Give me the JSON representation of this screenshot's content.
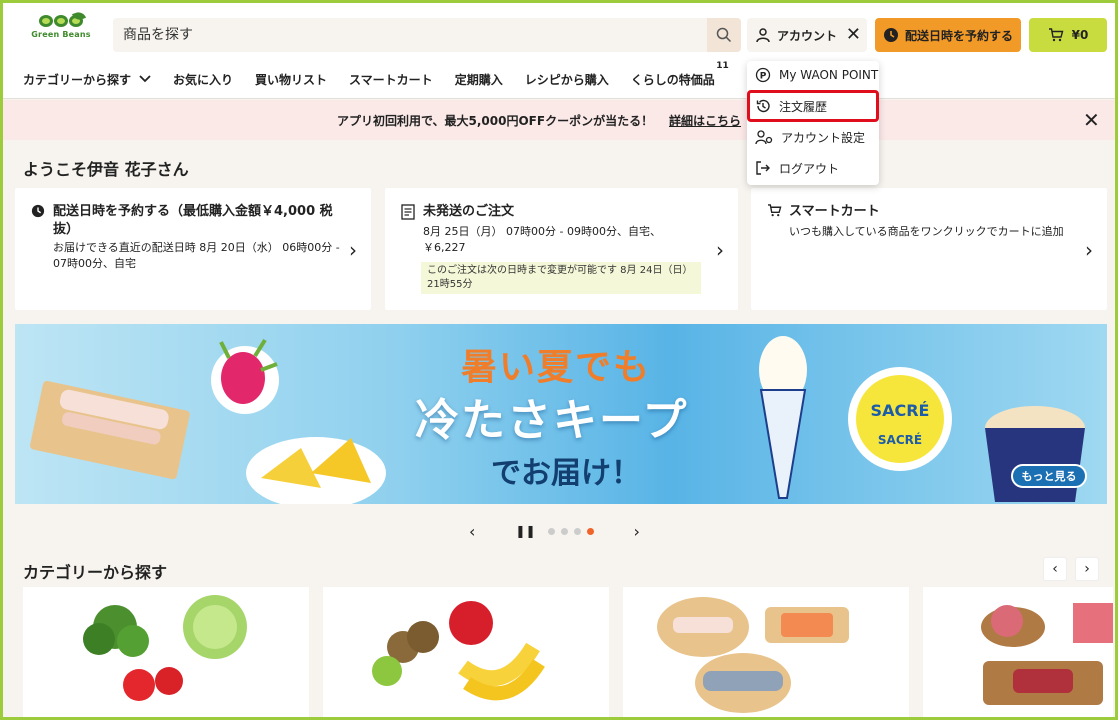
{
  "brand": {
    "logo_text": "Green Beans"
  },
  "search": {
    "placeholder": "商品を探す"
  },
  "header": {
    "account_label": "アカウント",
    "reserve_label": "配送日時を予約する",
    "cart_label": "¥0"
  },
  "nav": {
    "items": [
      {
        "label": "カテゴリーから探す"
      },
      {
        "label": "お気に入り"
      },
      {
        "label": "買い物リスト"
      },
      {
        "label": "スマートカート"
      },
      {
        "label": "定期購入"
      },
      {
        "label": "レシピから購入"
      },
      {
        "label": "くらしの特価品",
        "badge": "11"
      }
    ]
  },
  "account_menu": {
    "items": [
      {
        "label": "My WAON POINT",
        "icon": "waon-point-icon"
      },
      {
        "label": "注文履歴",
        "icon": "history-icon",
        "highlighted": true
      },
      {
        "label": "アカウント設定",
        "icon": "account-settings-icon"
      },
      {
        "label": "ログアウト",
        "icon": "logout-icon"
      }
    ]
  },
  "promo": {
    "text": "アプリ初回利用で、最大5,000円OFFクーポンが当たる！",
    "link": "詳細はこちら"
  },
  "welcome": {
    "text": "ようこそ伊音 花子さん"
  },
  "cards": [
    {
      "title": "配送日時を予約する（最低購入金額￥4,000 税抜）",
      "desc": "お届けできる直近の配送日時 8月 20日（水） 06時00分 - 07時00分、自宅",
      "icon": "clock-icon"
    },
    {
      "title": "未発送のご注文",
      "desc": "8月 25日（月） 07時00分 - 09時00分、自宅、￥6,227",
      "note": "このご注文は次の日時まで変更が可能です 8月 24日（日） 21時55分",
      "icon": "order-icon"
    },
    {
      "title": "スマートカート",
      "desc": "いつも購入している商品をワンクリックでカートに追加",
      "icon": "smart-cart-icon"
    }
  ],
  "banner": {
    "line1": "暑い夏でも",
    "line2": "冷たさキープ",
    "line3": "でお届け！",
    "more_label": "もっと見る"
  },
  "carousel": {
    "total": 4,
    "current": 4
  },
  "categories": {
    "title": "カテゴリーから探す"
  },
  "colors": {
    "accent_green": "#9ccc3c",
    "reserve_orange": "#f29a27",
    "cart_yellow_green": "#c8db3f",
    "highlight_red": "#e00d1c"
  }
}
